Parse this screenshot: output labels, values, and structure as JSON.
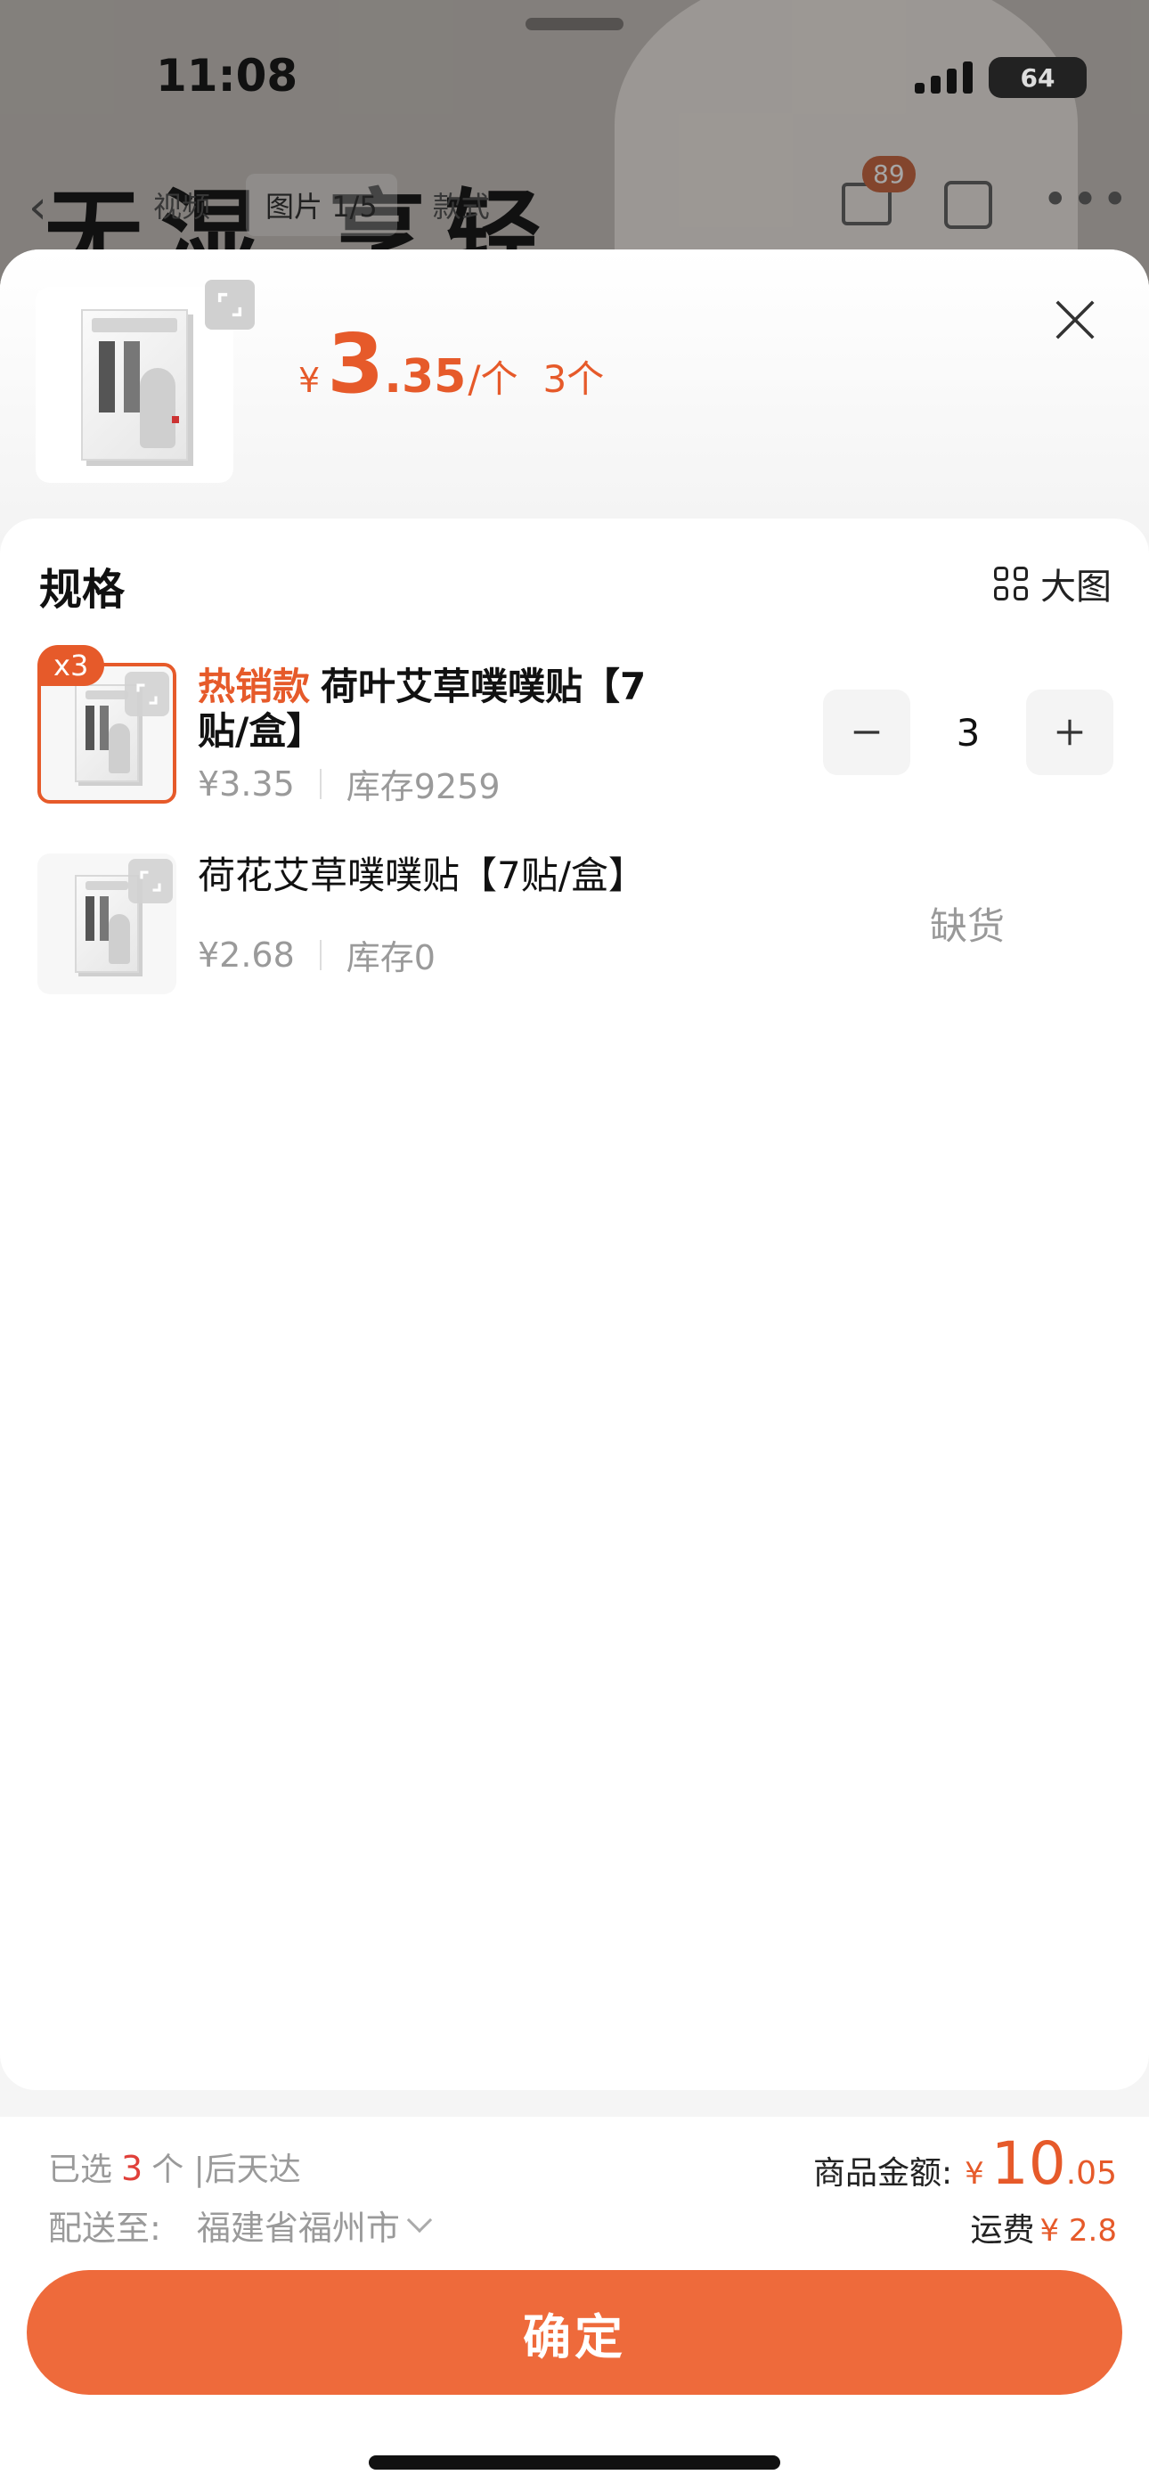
{
  "status": {
    "time": "11:08",
    "battery": "64"
  },
  "background": {
    "headline": "无湿 享轻",
    "tabs": [
      "视频",
      "图片 1/5",
      "款式"
    ],
    "cart_badge": "89"
  },
  "header": {
    "currency": "¥",
    "price_int": "3",
    "price_dec": ".35",
    "price_unit": "/个",
    "quantity_text": "3个"
  },
  "spec": {
    "title": "规格",
    "big_image_label": "大图",
    "items": [
      {
        "badge": "x3",
        "tag": "热销款",
        "name": "荷叶艾草噗噗贴【7贴/盒】",
        "price": "¥3.35",
        "stock": "库存9259",
        "quantity": "3",
        "selected": true
      },
      {
        "name": "荷花艾草噗噗贴【7贴/盒】",
        "price": "¥2.68",
        "stock": "库存0",
        "status": "缺货",
        "selected": false
      }
    ]
  },
  "footer": {
    "selected_prefix": "已选",
    "selected_count": "3",
    "selected_suffix": "个 |后天达",
    "ship_to_label": "配送至:",
    "address": "福建省福州市",
    "total_label": "商品金额:",
    "total_currency": "¥",
    "total_int": "10",
    "total_dec": ".05",
    "shipping_label": "运费",
    "shipping_value": "¥ 2.8",
    "confirm_label": "确定"
  },
  "colors": {
    "accent": "#e65a2a",
    "button": "#ee6a3b"
  }
}
